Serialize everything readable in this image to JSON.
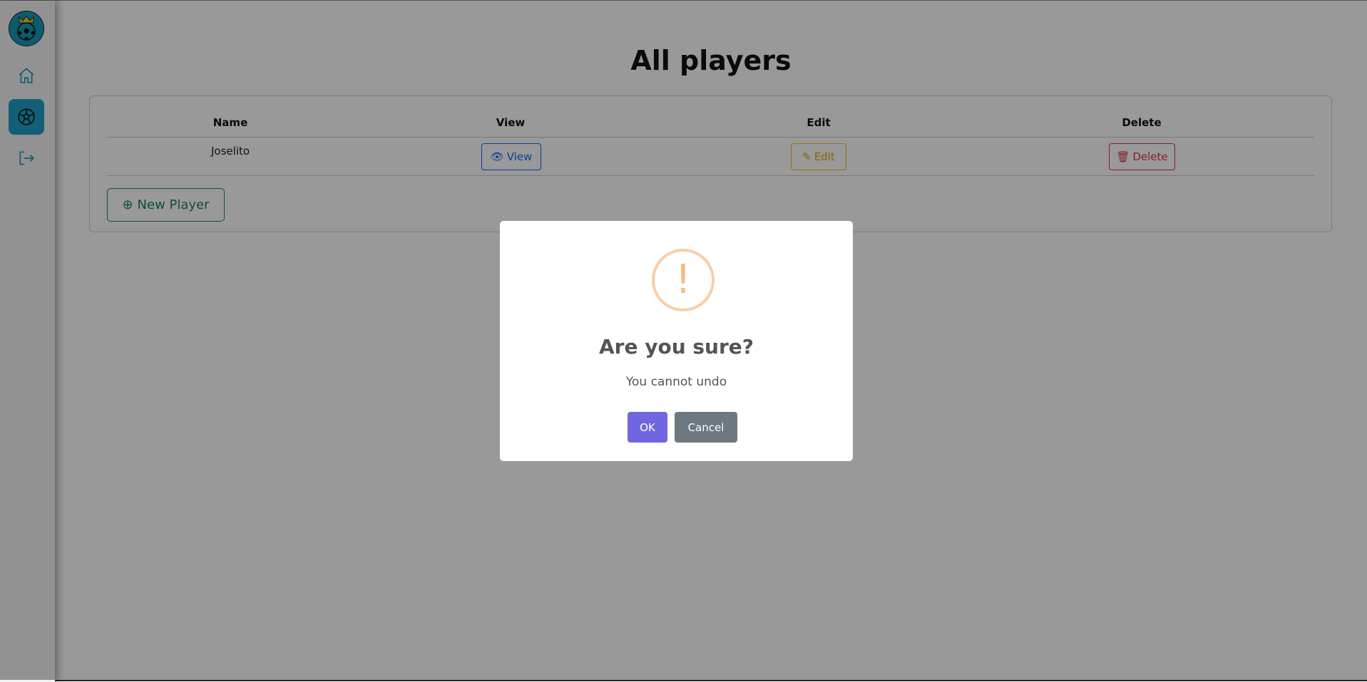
{
  "sidebar": {
    "items": [
      {
        "icon": "home-icon"
      },
      {
        "icon": "soccer-ball-icon",
        "active": true
      },
      {
        "icon": "logout-icon"
      }
    ]
  },
  "page": {
    "title": "All players"
  },
  "table": {
    "headers": [
      "Name",
      "View",
      "Edit",
      "Delete"
    ],
    "rows": [
      {
        "name": "Joselito",
        "view": "View",
        "edit": "Edit",
        "delete": "Delete"
      }
    ]
  },
  "new_player": "New Player",
  "dialog": {
    "icon": "!",
    "title": "Are you sure?",
    "text": "You cannot undo",
    "ok": "OK",
    "cancel": "Cancel"
  },
  "colors": {
    "accent": "#1da1c9",
    "ok": "#7066e0",
    "cancel": "#6e7881",
    "warning": "#f8bb86"
  }
}
